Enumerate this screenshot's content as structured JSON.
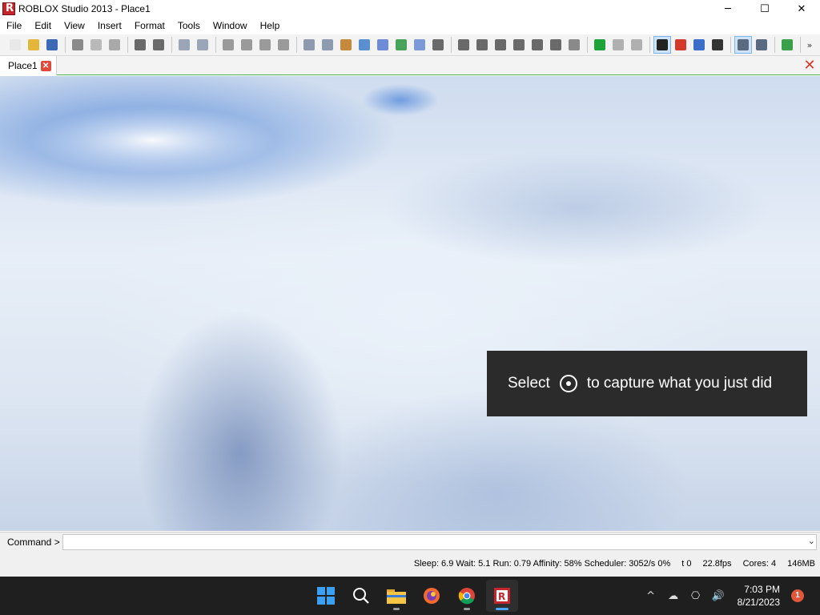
{
  "window": {
    "title": "ROBLOX Studio 2013 - Place1",
    "controls": [
      "─",
      "☐",
      "✕"
    ]
  },
  "menu": [
    "File",
    "Edit",
    "View",
    "Insert",
    "Format",
    "Tools",
    "Window",
    "Help"
  ],
  "toolbar": {
    "groups": [
      [
        {
          "name": "new-icon",
          "color": "#e8e8e8"
        },
        {
          "name": "open-folder-icon",
          "color": "#e5b53a"
        },
        {
          "name": "save-icon",
          "color": "#3b69b5"
        }
      ],
      [
        {
          "name": "cut-icon",
          "color": "#8a8a8a"
        },
        {
          "name": "copy-icon",
          "color": "#b9b9b9"
        },
        {
          "name": "paste-icon",
          "color": "#a9a9a9"
        }
      ],
      [
        {
          "name": "undo-icon",
          "color": "#6a6a6a"
        },
        {
          "name": "redo-icon",
          "color": "#6a6a6a"
        }
      ],
      [
        {
          "name": "group-icon",
          "color": "#9aa6b8"
        },
        {
          "name": "ungroup-icon",
          "color": "#9aa6b8"
        }
      ],
      [
        {
          "name": "lock-icon",
          "color": "#9a9a9a"
        },
        {
          "name": "anchor-icon",
          "color": "#9a9a9a"
        },
        {
          "name": "drop-icon",
          "color": "#9a9a9a"
        },
        {
          "name": "weld-icon",
          "color": "#9a9a9a"
        }
      ],
      [
        {
          "name": "explorer-icon",
          "color": "#8d9ab0"
        },
        {
          "name": "properties-icon",
          "color": "#8d9ab0"
        },
        {
          "name": "toolbox-icon",
          "color": "#c48a3a"
        },
        {
          "name": "output-icon",
          "color": "#5a8fd0"
        },
        {
          "name": "command-bar-icon",
          "color": "#6d8bd8"
        },
        {
          "name": "hierarchy-icon",
          "color": "#4aa35a"
        },
        {
          "name": "grid-icon",
          "color": "#7d9ad8"
        },
        {
          "name": "script-icon",
          "color": "#6a6a6a"
        }
      ],
      [
        {
          "name": "rotate-left-icon",
          "color": "#6a6a6a"
        },
        {
          "name": "rotate-right-icon",
          "color": "#6a6a6a"
        },
        {
          "name": "tilt-left-icon",
          "color": "#6a6a6a"
        },
        {
          "name": "tilt-right-icon",
          "color": "#6a6a6a"
        },
        {
          "name": "move-up-icon",
          "color": "#6a6a6a"
        },
        {
          "name": "move-down-icon",
          "color": "#6a6a6a"
        },
        {
          "name": "zoom-extents-icon",
          "color": "#8a8a8a"
        }
      ],
      [
        {
          "name": "play-icon",
          "color": "#1ea33a"
        },
        {
          "name": "pause-icon",
          "color": "#b0b0b0"
        },
        {
          "name": "reset-icon",
          "color": "#b0b0b0"
        }
      ],
      [
        {
          "name": "select-icon",
          "color": "#222222",
          "active": true
        },
        {
          "name": "move-icon",
          "color": "#d43a2a"
        },
        {
          "name": "resize-icon",
          "color": "#3b6ec9"
        },
        {
          "name": "rotate-icon",
          "color": "#333333"
        }
      ],
      [
        {
          "name": "snap-stud-icon",
          "color": "#5a6a80",
          "active": true
        },
        {
          "name": "snap-off-icon",
          "color": "#5a6a80"
        }
      ],
      [
        {
          "name": "insert-object-icon",
          "color": "#3aa04a"
        }
      ]
    ],
    "overflow": "»"
  },
  "tabs": {
    "doc_tab": "Place1",
    "close_glyph": "✕",
    "strip_close_glyph": "✕"
  },
  "toast": {
    "before": "Select",
    "after": "to capture what you just did"
  },
  "command": {
    "label": "Command >",
    "value": "",
    "dropdown": "⌄"
  },
  "status": {
    "fields": [
      "Sleep: 6.9 Wait: 5.1 Run: 0.79 Affinity: 58% Scheduler: 3052/s 0%",
      "t 0",
      "22.8fps",
      "Cores: 4",
      "146MB"
    ]
  },
  "taskbar": {
    "apps": [
      {
        "name": "start-button"
      },
      {
        "name": "search-button"
      },
      {
        "name": "file-explorer-button"
      },
      {
        "name": "firefox-button"
      },
      {
        "name": "chrome-button"
      },
      {
        "name": "roblox-studio-button",
        "active": true
      }
    ],
    "tray": {
      "chevron": "^",
      "cloud": "☁",
      "network": "⎔",
      "volume": "🔊",
      "time": "7:03 PM",
      "date": "8/21/2023",
      "notification_count": "1"
    }
  }
}
